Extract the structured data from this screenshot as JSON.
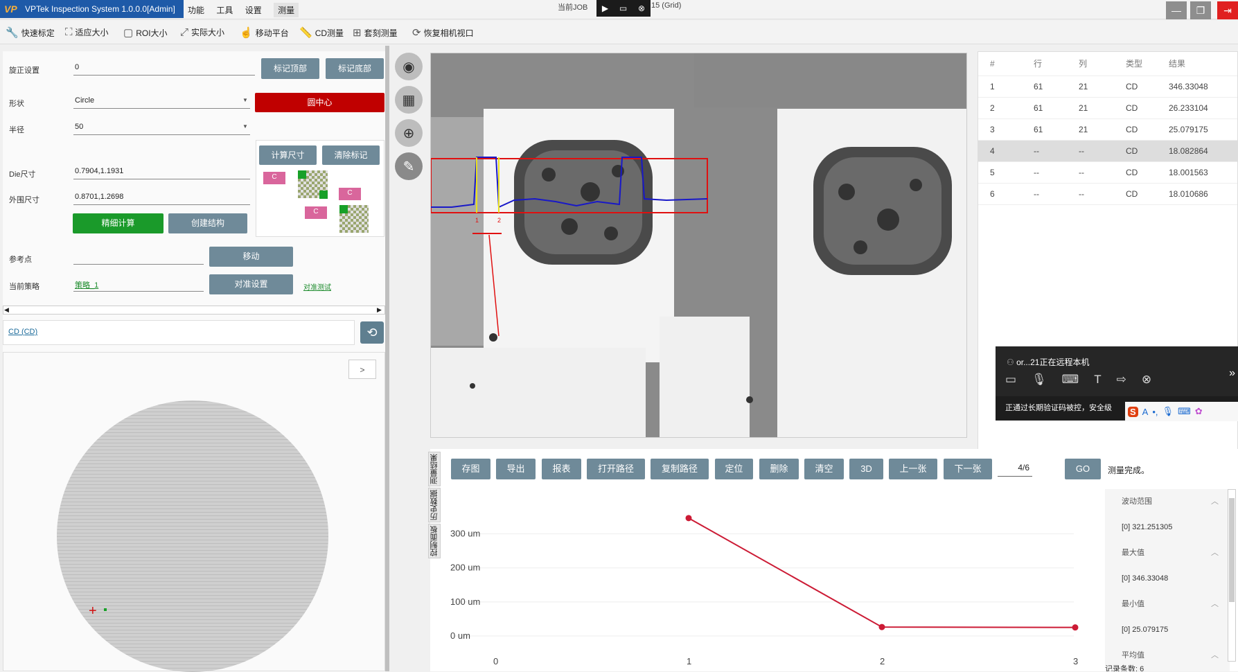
{
  "app": {
    "title": "VPTek Inspection System 1.0.0.0[Admin]",
    "logo": "VP"
  },
  "menu": [
    "功能",
    "工具",
    "设置",
    "测量"
  ],
  "job": {
    "prefix": "当前JOB",
    "suffix": "15 (Grid)"
  },
  "toolbar": [
    {
      "icon": "wrench-icon",
      "label": "快速标定"
    },
    {
      "icon": "fit-icon",
      "label": "适应大小"
    },
    {
      "icon": "roi-icon",
      "label": "ROI大小"
    },
    {
      "icon": "expand-icon",
      "label": "实际大小"
    },
    {
      "icon": "hand-icon",
      "label": "移动平台"
    },
    {
      "icon": "ruler-icon",
      "label": "CD测量"
    },
    {
      "icon": "plus-icon",
      "label": "套刻测量"
    },
    {
      "icon": "refresh-camera-icon",
      "label": "恢复相机视口"
    }
  ],
  "left": {
    "rotation_label": "旋正设置",
    "rotation_value": "0",
    "mark_top": "标记顶部",
    "mark_bottom": "标记底部",
    "shape_label": "形状",
    "shape_value": "Circle",
    "center_btn": "圆中心",
    "radius_label": "半径",
    "radius_value": "50",
    "calc_btn": "计算尺寸",
    "clear_btn": "清除标记",
    "die_label": "Die尺寸",
    "die_value": "0.7904,1.1931",
    "outer_label": "外围尺寸",
    "outer_value": "0.8701,1.2698",
    "fine_btn": "精细计算",
    "create_btn": "创建结构",
    "ref_label": "参考点",
    "ref_value": "",
    "move_btn": "移动",
    "strategy_label": "当前策略",
    "strategy_value": "策略_1",
    "align_btn": "对准设置",
    "align_test": "对准测试",
    "marker_c": "C",
    "cd_link": "CD (CD)",
    "expand_btn": ">"
  },
  "results": {
    "headers": [
      "#",
      "行",
      "列",
      "类型",
      "结果"
    ],
    "rows": [
      [
        "1",
        "61",
        "21",
        "CD",
        "346.33048"
      ],
      [
        "2",
        "61",
        "21",
        "CD",
        "26.233104"
      ],
      [
        "3",
        "61",
        "21",
        "CD",
        "25.079175"
      ],
      [
        "4",
        "--",
        "--",
        "CD",
        "18.082864"
      ],
      [
        "5",
        "--",
        "--",
        "CD",
        "18.001563"
      ],
      [
        "6",
        "--",
        "--",
        "CD",
        "18.010686"
      ]
    ],
    "selected_row": 3
  },
  "remote": {
    "status": "or...21正在远程本机",
    "notice": "正通过长期验证码被控，安全级"
  },
  "bottom": {
    "side_tabs": [
      "测量结果",
      "历史数据",
      "控制面板"
    ],
    "buttons": [
      "存图",
      "导出",
      "报表",
      "打开路径",
      "复制路径",
      "定位",
      "删除",
      "清空",
      "3D",
      "上一张",
      "下一张"
    ],
    "page": "4/6",
    "go": "GO",
    "status": "测量完成。"
  },
  "chart_data": {
    "type": "line",
    "x": [
      0,
      1,
      2,
      3
    ],
    "y": [
      null,
      346.33048,
      26.233104,
      25.079175
    ],
    "xticks": [
      "0",
      "1",
      "2",
      "3"
    ],
    "yticks": [
      "300 um",
      "200 um",
      "100 um",
      "0 um"
    ],
    "ylim": [
      0,
      346
    ],
    "color": "#cc1b35"
  },
  "stats": [
    {
      "label": "波动范围",
      "value": "[0]    321.251305"
    },
    {
      "label": "最大值",
      "value": "[0]    346.33048"
    },
    {
      "label": "最小值",
      "value": "[0]    25.079175"
    },
    {
      "label": "平均值",
      "value": ""
    }
  ],
  "stats_footer": "记录条数: 6",
  "markers": [
    "1",
    "2"
  ]
}
